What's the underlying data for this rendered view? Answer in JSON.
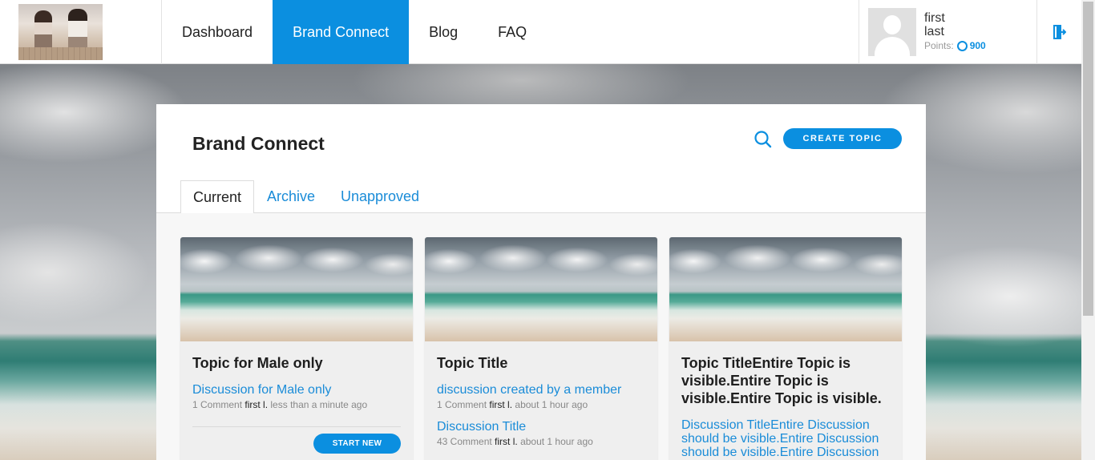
{
  "nav": {
    "items": [
      {
        "label": "Dashboard"
      },
      {
        "label": "Brand Connect"
      },
      {
        "label": "Blog"
      },
      {
        "label": "FAQ"
      }
    ],
    "active": "Brand Connect"
  },
  "user": {
    "first_name": "first",
    "last_name": "last",
    "points_label": "Points:",
    "points_value": "900"
  },
  "page": {
    "title": "Brand Connect",
    "create_label": "CREATE TOPIC",
    "tabs": [
      {
        "label": "Current"
      },
      {
        "label": "Archive"
      },
      {
        "label": "Unapproved"
      }
    ],
    "active_tab": "Current"
  },
  "cards": [
    {
      "title": "Topic for Male only",
      "discussions": [
        {
          "title": "Discussion for Male only",
          "count": "1 Comment",
          "author": "first l.",
          "time": "less than a minute ago"
        }
      ],
      "button": "START NEW"
    },
    {
      "title": "Topic Title",
      "discussions": [
        {
          "title": "discussion created by a member",
          "count": "1 Comment",
          "author": "first l.",
          "time": "about 1 hour ago"
        },
        {
          "title": "Discussion Title",
          "count": "43 Comment",
          "author": "first l.",
          "time": "about 1 hour ago"
        }
      ]
    },
    {
      "title": "Topic TitleEntire Topic is visible.Entire Topic is visible.Entire Topic is visible.",
      "discussions": [
        {
          "title": "Discussion TitleEntire Discussion should be visible.Entire Discussion should be visible.Entire Discussion"
        }
      ]
    }
  ],
  "colors": {
    "accent": "#0b8fe0",
    "link": "#1a8cd8"
  },
  "icons": {
    "search": "search-icon",
    "logout": "logout-icon",
    "points": "points-icon"
  }
}
